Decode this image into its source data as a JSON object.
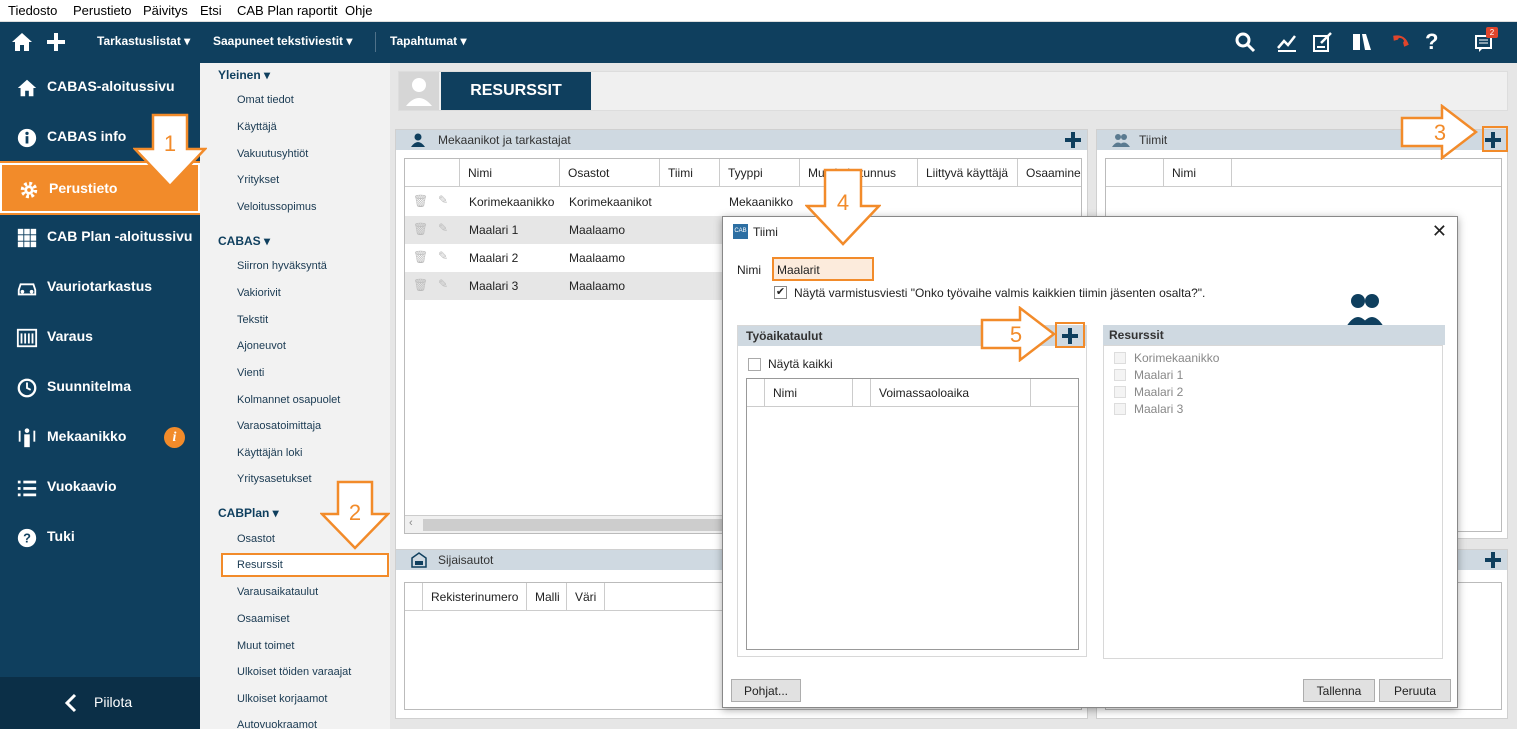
{
  "menubar": [
    "Tiedosto",
    "Perustieto",
    "Päivitys",
    "Etsi",
    "CAB Plan raportit",
    "Ohje"
  ],
  "topnav": {
    "items": [
      "Tarkastuslistat",
      "Saapuneet tekstiviestit",
      "Tapahtumat"
    ],
    "notification_count": "2"
  },
  "sidebar": {
    "items": [
      {
        "label": "CABAS-aloitussivu",
        "icon": "home-icon"
      },
      {
        "label": "CABAS info",
        "icon": "info-icon"
      },
      {
        "label": "Perustieto",
        "icon": "gear-icon"
      },
      {
        "label": "CAB Plan -aloitussivu",
        "icon": "grid-icon"
      },
      {
        "label": "Vauriotarkastus",
        "icon": "car-icon"
      },
      {
        "label": "Varaus",
        "icon": "calendar-icon"
      },
      {
        "label": "Suunnitelma",
        "icon": "clock-icon"
      },
      {
        "label": "Mekaanikko",
        "icon": "tools-icon"
      },
      {
        "label": "Vuokaavio",
        "icon": "list-icon"
      },
      {
        "label": "Tuki",
        "icon": "help-icon"
      }
    ],
    "active_index": 2,
    "hide_label": "Piilota",
    "accent": "#f28b2a",
    "bg": "#0f3f5e"
  },
  "submenu": {
    "sections": [
      {
        "title": "Yleinen",
        "items": [
          "Omat tiedot",
          "Käyttäjä",
          "Vakuutusyhtiöt",
          "Yritykset",
          "Veloitussopimus"
        ]
      },
      {
        "title": "CABAS",
        "items": [
          "Siirron hyväksyntä",
          "Vakiorivit",
          "Tekstit",
          "Ajoneuvot",
          "Vienti",
          "Kolmannet osapuolet",
          "Varaosatoimittaja",
          "Käyttäjän loki",
          "Yritysasetukset"
        ]
      },
      {
        "title": "CABPlan",
        "items": [
          "Osastot",
          "Resurssit",
          "Varausaikataulut",
          "Osaamiset",
          "Muut toimet",
          "Ulkoiset töiden varaajat",
          "Ulkoiset korjaamot",
          "Autovuokraamot"
        ]
      }
    ],
    "selected": "Resurssit"
  },
  "page": {
    "title": "RESURSSIT"
  },
  "mechanics": {
    "title": "Mekaanikot ja tarkastajat",
    "columns": [
      "Nimi",
      "Osastot",
      "Tiimi",
      "Tyyppi",
      "Muu kuin tunnus",
      "Liittyvä käyttäjä",
      "Osaaminen"
    ],
    "rows": [
      {
        "name": "Korimekaanikko",
        "dept": "Korimekaanikot",
        "team": "",
        "type": "Mekaanikko"
      },
      {
        "name": "Maalari 1",
        "dept": "Maalaamo",
        "team": "",
        "type": ""
      },
      {
        "name": "Maalari 2",
        "dept": "Maalaamo",
        "team": "",
        "type": ""
      },
      {
        "name": "Maalari 3",
        "dept": "Maalaamo",
        "team": "",
        "type": ""
      }
    ]
  },
  "teams": {
    "title": "Tiimit",
    "columns": [
      "Nimi"
    ]
  },
  "substitutes": {
    "title": "Sijaisautot",
    "columns": [
      "Rekisterinumero",
      "Malli",
      "Väri"
    ]
  },
  "dialog": {
    "title": "Tiimi",
    "name_label": "Nimi",
    "name_value": "Maalarit",
    "confirm_text": "Näytä varmistusviesti \"Onko työvaihe valmis kaikkien tiimin jäsenten osalta?\".",
    "confirm_checked": true,
    "schedules": {
      "title": "Työaikataulut",
      "show_all": "Näytä kaikki",
      "columns": [
        "Nimi",
        "Voimassaoloaika"
      ]
    },
    "resources": {
      "title": "Resurssit",
      "items": [
        "Korimekaanikko",
        "Maalari 1",
        "Maalari 2",
        "Maalari 3"
      ]
    },
    "templates_button": "Pohjat...",
    "save_button": "Tallenna",
    "cancel_button": "Peruuta"
  },
  "callouts": [
    "1",
    "2",
    "3",
    "4",
    "5"
  ]
}
